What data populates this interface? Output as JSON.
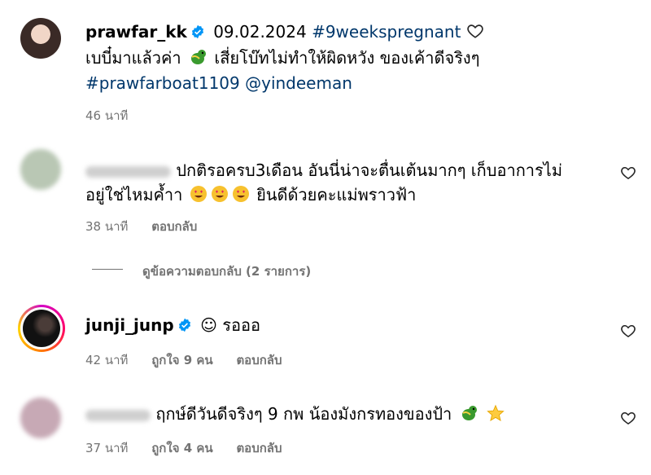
{
  "post": {
    "username": "prawfar_kk",
    "date": "09.02.2024",
    "hashtag_top": "#9weekspregnant",
    "caption": "เบบี๋มาแล้วค่า",
    "caption2": "เสี่ยโบ๊ทไม่ทำให้ผิดหวัง ของเค้าดีจริงๆ",
    "hashtag": "#prawfarboat1109",
    "mention": "@yindeeman",
    "time": "46 นาที"
  },
  "comments": [
    {
      "line1": "ปกติรอครบ3เดือน อันนี่น่าจะตื่นเต้นมากๆ เก็บอาการไม่",
      "line2a": "อยู่ใช่ไหมค้ำา",
      "line2b": "ยินดีด้วยคะแม่พราวฟ้า",
      "time": "38 นาที",
      "reply": "ตอบกลับ",
      "view_replies": "ดูข้อความตอบกลับ (2 รายการ)"
    },
    {
      "username": "junji_junp",
      "text": "☺ รอออ",
      "time": "42 นาที",
      "likes": "ถูกใจ 9 คน",
      "reply": "ตอบกลับ"
    },
    {
      "text": "ฤกษ์ดีวันดีจริงๆ 9 กพ น้องมังกรทองของป้า",
      "time": "37 นาที",
      "likes": "ถูกใจ 4 คน",
      "reply": "ตอบกลับ"
    }
  ],
  "icons": {
    "verified": "verified-badge-icon",
    "heart": "heart-outline-icon",
    "dragon": "dragon-emoji",
    "heart_eyes": "heart-eyes-emoji",
    "star": "star-emoji"
  },
  "colors": {
    "verified": "#0095f6",
    "link": "#00376b",
    "meta": "#737373"
  }
}
